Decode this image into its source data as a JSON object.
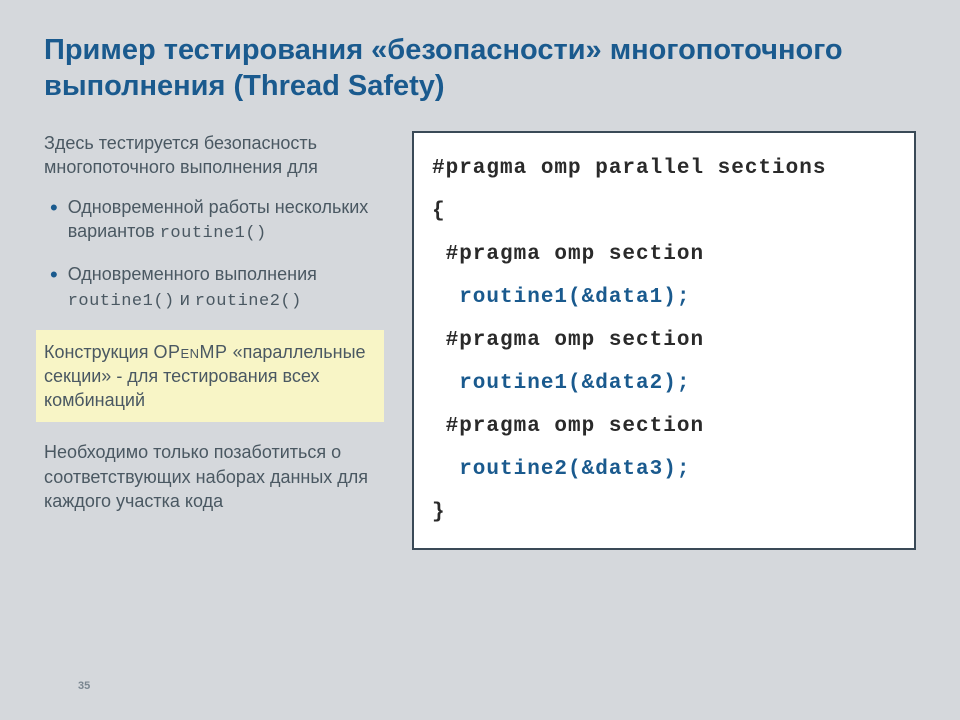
{
  "title": "Пример тестирования «безопасности» многопоточного выполнения (Thread Safety)",
  "lead": "Здесь тестируется безопасность многопоточного выполнения для",
  "bullet1_pre": "Одновременной работы нескольких вариантов ",
  "bullet1_code": "routine1()",
  "bullet2_pre": "Одновременного выполнения ",
  "bullet2_code1": "routine1()",
  "bullet2_mid": " и ",
  "bullet2_code2": "routine2()",
  "highlight_pre": "Конструкция ",
  "highlight_name": "OPenMP",
  "highlight_post": " «параллельные секции» - для тестирования всех комбинаций",
  "trailing": "Необходимо только позаботиться о соответствующих наборах данных для каждого участка кода",
  "code": {
    "l1": "#pragma omp parallel sections",
    "l2": "{",
    "l3": " #pragma omp section",
    "l4": "  routine1(&data1);",
    "l5": " #pragma omp section",
    "l6": "  routine1(&data2);",
    "l7": " #pragma omp section",
    "l8": "  routine2(&data3);",
    "l9": "}"
  },
  "slide_number": "35"
}
